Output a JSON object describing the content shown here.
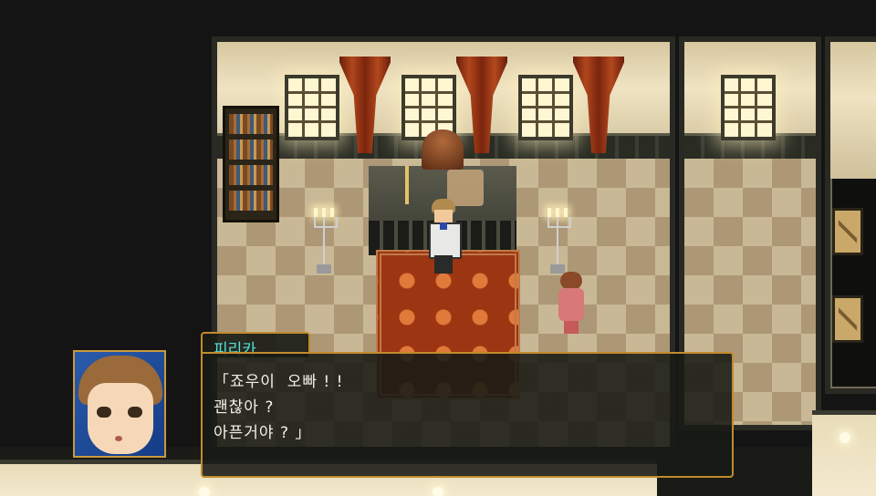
{
  "dialogue": {
    "speaker": "피리카",
    "lines": [
      "「죠우이  오빠 ! !",
      "괜찮아 ?",
      "아픈거야 ? 」"
    ]
  },
  "colors": {
    "speaker_name": "#4fe0d6",
    "dialogue_border": "#c38a2c",
    "dialogue_text": "#f3f1e8"
  }
}
